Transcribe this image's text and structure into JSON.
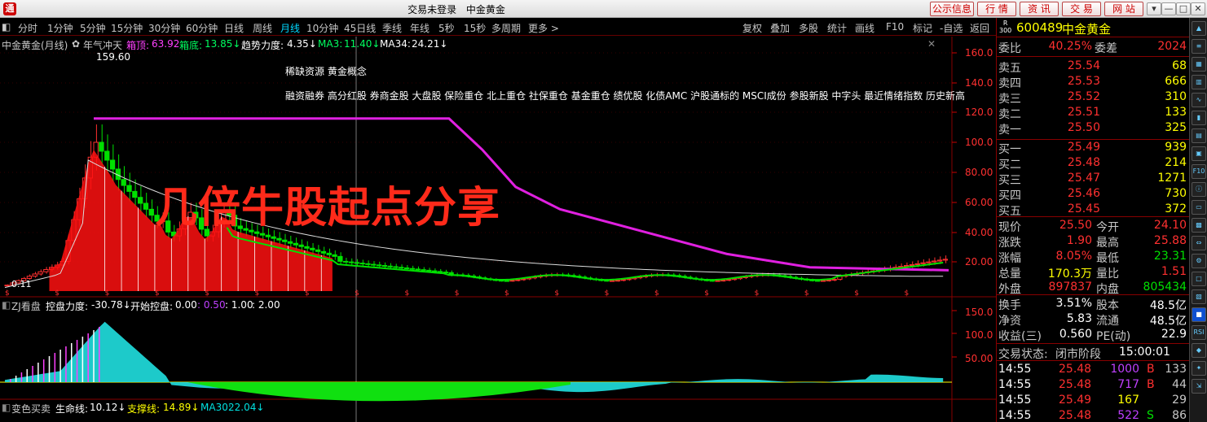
{
  "window": {
    "title_parts": [
      "交易未登录",
      "中金黄金"
    ],
    "buttons": [
      "公示信息",
      "行 情",
      "资 讯",
      "交 易",
      "网 站"
    ],
    "window_controls": [
      "▾",
      "—",
      "□",
      "✕"
    ]
  },
  "period_bar": {
    "tabs": [
      "分时",
      "1分钟",
      "5分钟",
      "15分钟",
      "30分钟",
      "60分钟",
      "日线",
      "周线",
      "月线",
      "10分钟",
      "45日线",
      "季线",
      "年线",
      "5秒",
      "15秒",
      "多周期",
      "更多 >"
    ],
    "active": "月线",
    "tools": [
      "复权",
      "叠加",
      "多股",
      "统计",
      "画线",
      "F10",
      "标记",
      "-自选",
      "返回"
    ]
  },
  "main_chart": {
    "legend": {
      "name": "中金黄金(月线)",
      "indicator": "年气冲天",
      "box_top_label": "箱顶:",
      "box_top_value": "63.92",
      "box_bottom_label": "箱底:",
      "box_bottom_value": "13.85↓",
      "trend_label": "趋势力度:",
      "trend_value": "4.35↓",
      "ma3_label": "MA3:",
      "ma3_value": "11.40↓",
      "ma34_label": "MA34:",
      "ma34_value": "24.21↓"
    },
    "concept_line1": "稀缺资源  黄金概念",
    "concept_line2": "融资融券 高分红股 券商金股 大盘股 保险重仓 北上重仓 社保重仓 基金重仓 绩优股 化债AMC 沪股通标的 MSCI成份 参股新股 中字头 最近情绪指数 历史新高",
    "watermark": "几倍牛股起点分享",
    "peak_label": "159.60",
    "low_label": "0.11",
    "y_ticks": [
      "160.0",
      "140.0",
      "120.0",
      "100.0",
      "80.00",
      "60.00",
      "40.00",
      "20.00"
    ]
  },
  "sub_chart1": {
    "name": "ZJ看盘",
    "label1": "控盘力度:",
    "value1": "-30.78↓",
    "label2": "开始控盘:",
    "value2": "0.00",
    "value3": ": 0.50",
    "value4": ": 1.00",
    "value5": ": 2.00",
    "y_ticks": [
      "150.0",
      "100.0",
      "50.00"
    ]
  },
  "sub_chart2": {
    "name": "变色买卖",
    "label1": "生命线:",
    "value1": "10.12↓",
    "label2": "支撑线:",
    "value2": "14.89↓",
    "label3": "MA30:",
    "value3": "22.04↓"
  },
  "quote": {
    "market": "R\n300",
    "code": "600489",
    "name": "中金黄金",
    "weibi_label": "委比",
    "weibi_value": "40.25%",
    "weicha_label": "委差",
    "weicha_value": "2024",
    "asks": [
      {
        "label": "卖五",
        "price": "25.54",
        "vol": "68"
      },
      {
        "label": "卖四",
        "price": "25.53",
        "vol": "666"
      },
      {
        "label": "卖三",
        "price": "25.52",
        "vol": "310"
      },
      {
        "label": "卖二",
        "price": "25.51",
        "vol": "133"
      },
      {
        "label": "卖一",
        "price": "25.50",
        "vol": "325"
      }
    ],
    "bids": [
      {
        "label": "买一",
        "price": "25.49",
        "vol": "939"
      },
      {
        "label": "买二",
        "price": "25.48",
        "vol": "214"
      },
      {
        "label": "买三",
        "price": "25.47",
        "vol": "1271"
      },
      {
        "label": "买四",
        "price": "25.46",
        "vol": "730"
      },
      {
        "label": "买五",
        "price": "25.45",
        "vol": "372"
      }
    ],
    "stats": [
      {
        "l1": "现价",
        "v1": "25.50",
        "c1": "#ff3030",
        "l2": "今开",
        "v2": "24.10",
        "c2": "#ff3030"
      },
      {
        "l1": "涨跌",
        "v1": "1.90",
        "c1": "#ff3030",
        "l2": "最高",
        "v2": "25.88",
        "c2": "#ff3030"
      },
      {
        "l1": "涨幅",
        "v1": "8.05%",
        "c1": "#ff3030",
        "l2": "最低",
        "v2": "23.31",
        "c2": "#00e000"
      },
      {
        "l1": "总量",
        "v1": "170.3万",
        "c1": "#ffff00",
        "l2": "量比",
        "v2": "1.51",
        "c2": "#ff3030"
      },
      {
        "l1": "外盘",
        "v1": "897837",
        "c1": "#ff3030",
        "l2": "内盘",
        "v2": "805434",
        "c2": "#00e000"
      }
    ],
    "stats2": [
      {
        "l1": "换手",
        "v1": "3.51%",
        "l2": "股本",
        "v2": "48.5亿"
      },
      {
        "l1": "净资",
        "v1": "5.83",
        "l2": "流通",
        "v2": "48.5亿"
      },
      {
        "l1": "收益(三)",
        "v1": "0.560",
        "l2": "PE(动)",
        "v2": "22.9"
      }
    ],
    "trade_status_label": "交易状态:",
    "trade_status": "闭市阶段",
    "trade_time": "15:00:01",
    "ticks": [
      {
        "time": "14:55",
        "price": "25.48",
        "vol": "1000",
        "vc": "#c040ff",
        "side": "B",
        "sc": "#ff3030",
        "num": "133"
      },
      {
        "time": "14:55",
        "price": "25.48",
        "vol": "717",
        "vc": "#c040ff",
        "side": "B",
        "sc": "#ff3030",
        "num": "44"
      },
      {
        "time": "14:55",
        "price": "25.49",
        "vol": "167",
        "vc": "#ffff00",
        "side": "",
        "sc": "#ff3030",
        "num": "29"
      },
      {
        "time": "14:55",
        "price": "25.48",
        "vol": "522",
        "vc": "#c040ff",
        "side": "S",
        "sc": "#00e000",
        "num": "86"
      }
    ]
  },
  "sidebar_icons": [
    "up-arrow-icon",
    "list-icon",
    "grid-icon",
    "chart-icon",
    "line-chart-icon",
    "candlestick-icon",
    "bars-icon",
    "table-icon",
    "f10-icon",
    "info-icon",
    "doc-icon",
    "layout-icon",
    "compare-icon",
    "gear-icon",
    "square-icon",
    "chart2-icon",
    "blue-button-icon",
    "rsi-icon",
    "arrow-icon",
    "star-icon",
    "expand-icon"
  ]
}
